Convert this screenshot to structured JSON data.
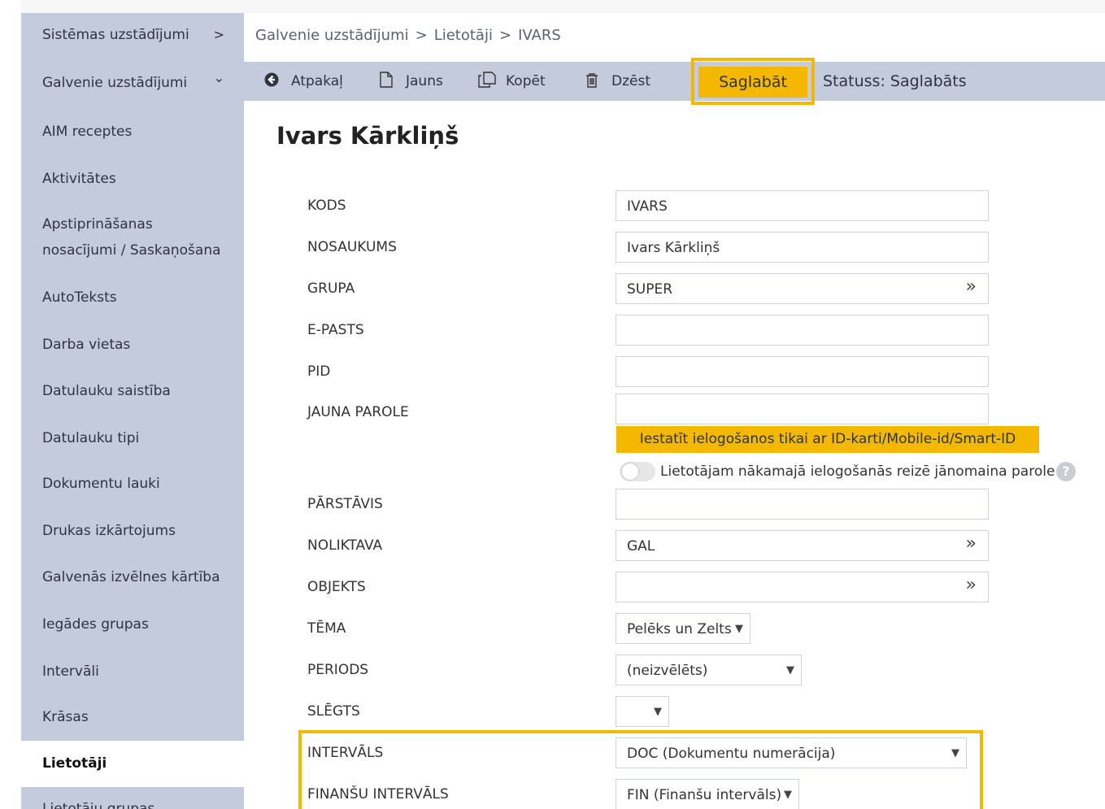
{
  "sidebar": {
    "items": [
      {
        "label": "Sistēmas uzstādījumi",
        "chevron": ">"
      },
      {
        "label": "Galvenie uzstādījumi",
        "chevron": "⌄"
      },
      {
        "label": "AIM receptes"
      },
      {
        "label": "Aktivitātes"
      },
      {
        "label": "Apstiprināšanas",
        "label2": "nosacījumi / Saskaņošana"
      },
      {
        "label": "AutoTeksts"
      },
      {
        "label": "Darba vietas"
      },
      {
        "label": "Datulauku saistība"
      },
      {
        "label": "Datulauku tipi"
      },
      {
        "label": "Dokumentu lauki"
      },
      {
        "label": "Drukas izkārtojums"
      },
      {
        "label": "Galvenās izvēlnes kārtība"
      },
      {
        "label": "Iegādes grupas"
      },
      {
        "label": "Intervāli"
      },
      {
        "label": "Krāsas"
      },
      {
        "label": "Lietotāji"
      },
      {
        "label": "Lietotāju grupas"
      }
    ]
  },
  "breadcrumb": {
    "items": [
      "Galvenie uzstādījumi",
      "Lietotāji",
      "IVARS"
    ],
    "separator": ">"
  },
  "toolbar": {
    "back_label": "Atpakaļ",
    "new_label": "Jauns",
    "copy_label": "Kopēt",
    "delete_label": "Dzēst",
    "save_label": "Saglabāt",
    "status_text": "Statuss: Saglabāts"
  },
  "title": "Ivars Kārkliņš",
  "form": {
    "kods": {
      "label": "KODS",
      "value": "IVARS"
    },
    "nosaukums": {
      "label": "NOSAUKUMS",
      "value": "Ivars Kārkliņš"
    },
    "grupa": {
      "label": "GRUPA",
      "value": "SUPER"
    },
    "epasts": {
      "label": "E-PASTS",
      "value": ""
    },
    "pid": {
      "label": "PID",
      "value": ""
    },
    "jauna_parole": {
      "label": "JAUNA PAROLE",
      "value": ""
    },
    "id_button": "Iestatīt ielogošanos tikai ar ID-karti/Mobile-id/Smart-ID",
    "change_password_toggle": {
      "label": "Lietotājam nākamajā ielogošanās reizē jānomaina parole",
      "on": false
    },
    "parstavis": {
      "label": "PĀRSTĀVIS",
      "value": ""
    },
    "noliktava": {
      "label": "NOLIKTAVA",
      "value": "GAL"
    },
    "objekts": {
      "label": "OBJEKTS",
      "value": ""
    },
    "tema": {
      "label": "TĒMA",
      "value": "Pelēks un Zelts"
    },
    "periods": {
      "label": "PERIODS",
      "value": "(neizvēlēts)"
    },
    "slegts": {
      "label": "SLĒGTS",
      "value": ""
    },
    "intervals": {
      "label": "INTERVĀLS",
      "value": "DOC (Dokumentu numerācija)"
    },
    "finansu_intervals": {
      "label": "FINANŠU INTERVĀLS",
      "value": "FIN (Finanšu intervāls)"
    }
  },
  "icons": {
    "double_chevron": "»",
    "dropdown_arrow": "▼",
    "help": "?"
  },
  "colors": {
    "sidebar_bg": "#c3cbdd",
    "accent": "#f5b800"
  }
}
